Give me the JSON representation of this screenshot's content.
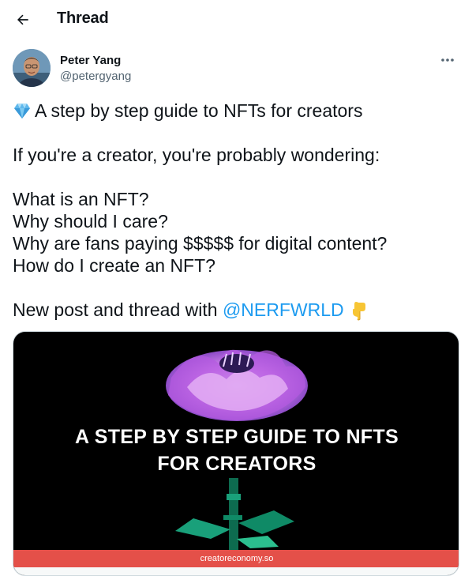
{
  "header": {
    "title": "Thread",
    "back_icon": "arrow-left-icon"
  },
  "author": {
    "name": "Peter Yang",
    "handle": "@petergyang",
    "more_icon": "more-horizontal-icon"
  },
  "tweet": {
    "title_emoji_icon": "gem-icon",
    "title": "A step by step guide to NFTs for creators",
    "intro": "If you're a creator, you're probably wondering:",
    "questions": [
      "What is an NFT?",
      "Why should I care?",
      "Why are fans paying $$$$$ for digital content?",
      "How do I create an NFT?"
    ],
    "closing_prefix": "New post and thread with",
    "mention": "@NERFWRLD",
    "closing_emoji_icon": "pointing-down-icon"
  },
  "media": {
    "heading_line1": "A STEP BY STEP GUIDE TO NFTS",
    "heading_line2": "FOR CREATORS",
    "footer_domain": "creatoreconomy.so",
    "image_icon": "flower-icon"
  },
  "colors": {
    "link": "#1d9bf0",
    "text": "#0f1419",
    "secondary": "#536471",
    "footer_bar": "#e45049"
  }
}
